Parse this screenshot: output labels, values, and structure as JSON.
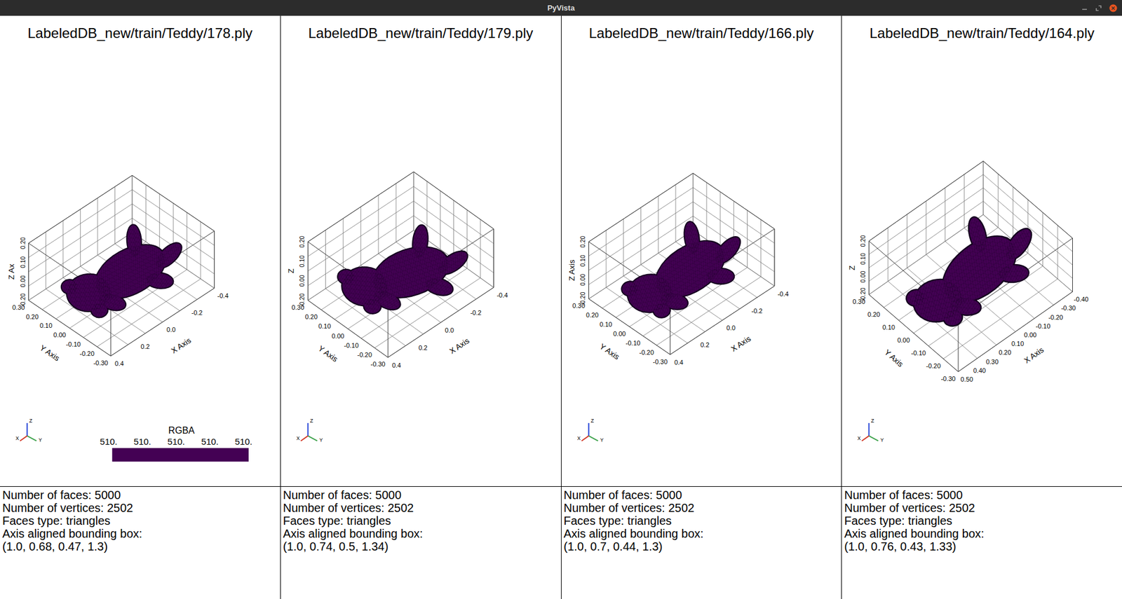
{
  "window": {
    "title": "PyVista"
  },
  "orientation": {
    "x": "X",
    "y": "Y",
    "z": "Z"
  },
  "plots": [
    {
      "title": "LabeledDB_new/train/Teddy/178.ply",
      "axes": {
        "x": {
          "label": "X Axis",
          "ticks": [
            "0.4",
            "0.2",
            "0.0",
            "-0.2",
            "-0.4"
          ]
        },
        "y": {
          "label": "Y Axis",
          "ticks": [
            "-0.30",
            "-0.20",
            "-0.10",
            "0.00",
            "0.10",
            "0.20",
            "0.30"
          ]
        },
        "z": {
          "label": "Z Ax",
          "ticks": [
            "-0.20",
            "0.00",
            "0.10",
            "0.20"
          ]
        }
      },
      "colorbar": {
        "title": "RGBA",
        "labels": [
          "510.",
          "510.",
          "510.",
          "510.",
          "510."
        ]
      },
      "info": [
        "Number of faces: 5000",
        "Number of vertices: 2502",
        "Faces type: triangles",
        "Axis aligned bounding box:",
        "(1.0, 0.68, 0.47, 1.3)"
      ]
    },
    {
      "title": "LabeledDB_new/train/Teddy/179.ply",
      "axes": {
        "x": {
          "label": "X Axis",
          "ticks": [
            "0.4",
            "0.2",
            "0.0",
            "-0.2",
            "-0.4"
          ]
        },
        "y": {
          "label": "Y Axis",
          "ticks": [
            "-0.30",
            "-0.20",
            "-0.10",
            "0.00",
            "0.10",
            "0.20",
            "0.30"
          ]
        },
        "z": {
          "label": "Z",
          "ticks": [
            "-0.20",
            "0.00",
            "0.10",
            "0.20"
          ]
        }
      },
      "info": [
        "Number of faces: 5000",
        "Number of vertices: 2502",
        "Faces type: triangles",
        "Axis aligned bounding box:",
        "(1.0, 0.74, 0.5, 1.34)"
      ]
    },
    {
      "title": "LabeledDB_new/train/Teddy/166.ply",
      "axes": {
        "x": {
          "label": "X Axis",
          "ticks": [
            "0.4",
            "0.2",
            "0.0",
            "-0.2",
            "-0.4"
          ]
        },
        "y": {
          "label": "Y Axis",
          "ticks": [
            "-0.30",
            "-0.20",
            "-0.10",
            "0.00",
            "0.10",
            "0.20",
            "0.30"
          ]
        },
        "z": {
          "label": "Z Axis",
          "ticks": [
            "-0.20",
            "0.00",
            "0.10",
            "0.20"
          ]
        }
      },
      "info": [
        "Number of faces: 5000",
        "Number of vertices: 2502",
        "Faces type: triangles",
        "Axis aligned bounding box:",
        "(1.0, 0.7, 0.44, 1.3)"
      ]
    },
    {
      "title": "LabeledDB_new/train/Teddy/164.ply",
      "axes": {
        "x": {
          "label": "X Axis",
          "ticks": [
            "0.50",
            "0.40",
            "0.30",
            "0.20",
            "0.10",
            "0.00",
            "-0.10",
            "-0.20",
            "-0.30",
            "-0.40"
          ]
        },
        "y": {
          "label": "Y Axis",
          "ticks": [
            "-0.30",
            "-0.20",
            "-0.10",
            "0.00",
            "0.10",
            "0.20",
            "0.30"
          ]
        },
        "z": {
          "label": "Z",
          "ticks": [
            "-0.20",
            "0.00",
            "0.10",
            "0.20"
          ]
        }
      },
      "info": [
        "Number of faces: 5000",
        "Number of vertices: 2502",
        "Faces type: triangles",
        "Axis aligned bounding box:",
        "(1.0, 0.76, 0.43, 1.33)"
      ]
    }
  ]
}
